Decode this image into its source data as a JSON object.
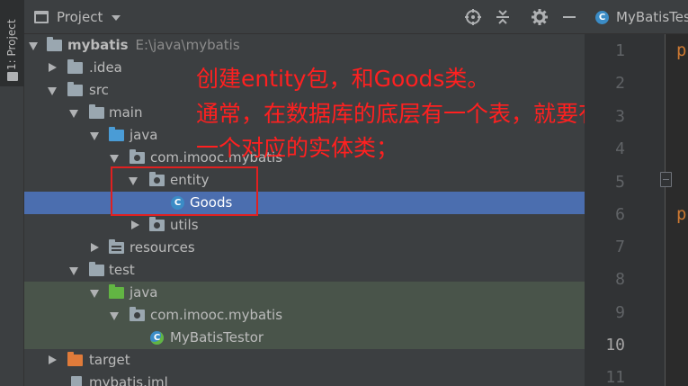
{
  "sidebar": {
    "tab_label": "1: Project",
    "tab_icon": "folder-icon"
  },
  "project_panel": {
    "title": "Project",
    "header_buttons": [
      "target-icon",
      "collapse-icon",
      "gear-icon",
      "minimize-icon"
    ],
    "tree": [
      {
        "label": "mybatis",
        "path": "E:\\java\\mybatis",
        "icon": "module-folder-icon",
        "expanded": true
      },
      {
        "label": ".idea",
        "icon": "folder-icon",
        "expanded": false
      },
      {
        "label": "src",
        "icon": "folder-icon",
        "expanded": true
      },
      {
        "label": "main",
        "icon": "folder-icon",
        "expanded": true
      },
      {
        "label": "java",
        "icon": "source-folder-icon",
        "expanded": true
      },
      {
        "label": "com.imooc.mybatis",
        "icon": "package-icon",
        "expanded": true
      },
      {
        "label": "entity",
        "icon": "package-icon",
        "expanded": true
      },
      {
        "label": "Goods",
        "icon": "class-icon",
        "selected": true
      },
      {
        "label": "utils",
        "icon": "package-icon",
        "expanded": false
      },
      {
        "label": "resources",
        "icon": "resources-folder-icon",
        "expanded": false
      },
      {
        "label": "test",
        "icon": "folder-icon",
        "expanded": true
      },
      {
        "label": "java",
        "icon": "test-source-folder-icon",
        "expanded": true
      },
      {
        "label": "com.imooc.mybatis",
        "icon": "package-icon",
        "expanded": true
      },
      {
        "label": "MyBatisTestor",
        "icon": "test-class-icon"
      },
      {
        "label": "target",
        "icon": "excluded-folder-icon",
        "expanded": false
      },
      {
        "label": "mybatis.iml",
        "icon": "file-icon"
      }
    ]
  },
  "annotation": {
    "line1": "创建entity包，和Goods类。",
    "line2": "通常，在数据库的底层有一个表，就要有",
    "line3": "一个对应的实体类；",
    "color": "#ff2020"
  },
  "editor": {
    "tab_label": "MyBatisTes",
    "line_numbers": [
      "1",
      "2",
      "3",
      "4",
      "5",
      "6",
      "7",
      "8",
      "9",
      "10",
      "11"
    ],
    "current_line": "10",
    "code_fragments": [
      "p",
      "p"
    ]
  },
  "colors": {
    "selection": "#4b6eaf",
    "test_background": "#49544a",
    "highlight_box": "#e02020"
  }
}
